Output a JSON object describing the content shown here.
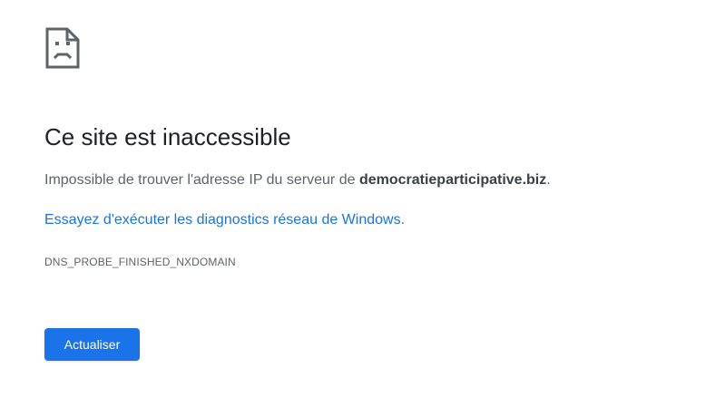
{
  "error_page": {
    "icon": "sad-page-icon",
    "title": "Ce site est inaccessible",
    "explanation_prefix": "Impossible de trouver l'adresse IP du serveur de ",
    "domain": "democratieparticipative.biz",
    "explanation_suffix": ".",
    "diagnostics_link": "Essayez d'exécuter les diagnostics réseau de Windows",
    "diagnostics_suffix": ".",
    "error_code": "DNS_PROBE_FINISHED_NXDOMAIN",
    "reload_button": "Actualiser"
  },
  "colors": {
    "accent": "#1a73e8",
    "title": "#202124",
    "body_text": "#5f6368",
    "icon": "#5f6368"
  }
}
